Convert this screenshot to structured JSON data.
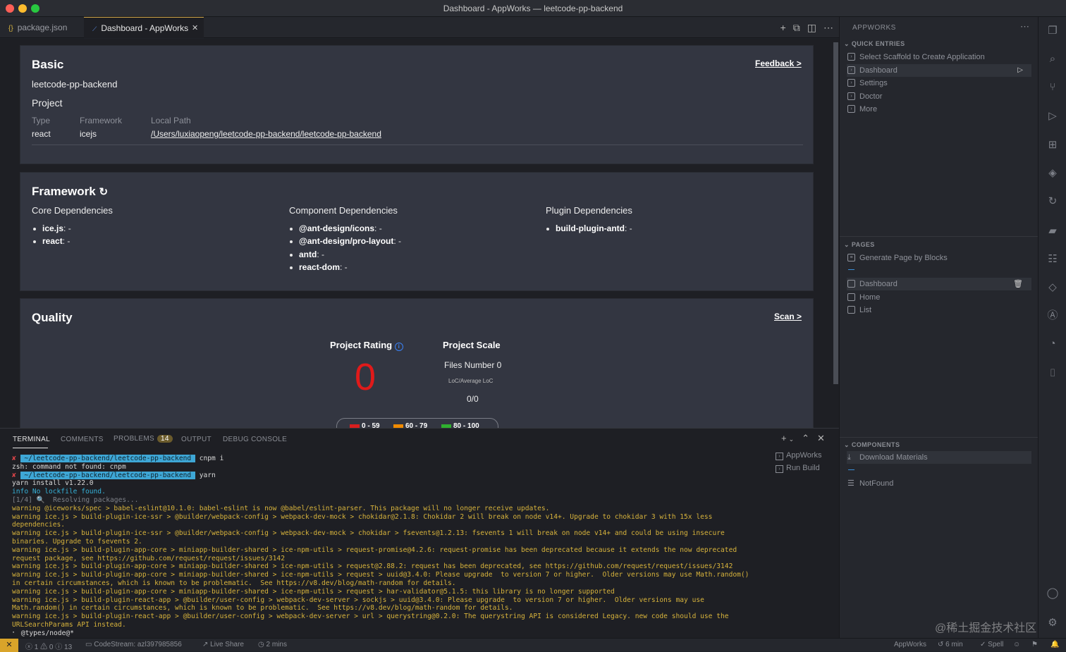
{
  "window": {
    "title": "Dashboard - AppWorks — leetcode-pp-backend"
  },
  "tabs": [
    {
      "label": "package.json",
      "icon": "{}"
    },
    {
      "label": "Dashboard - AppWorks",
      "close": "✕"
    }
  ],
  "basic": {
    "title": "Basic",
    "feedback": "Feedback >",
    "project_name": "leetcode-pp-backend",
    "project_label": "Project",
    "type_label": "Type",
    "framework_label": "Framework",
    "path_label": "Local Path",
    "type_value": "react",
    "framework_value": "icejs",
    "path_value": "/Users/luxiaopeng/leetcode-pp-backend/leetcode-pp-backend"
  },
  "framework": {
    "title": "Framework",
    "core_title": "Core Dependencies",
    "component_title": "Component Dependencies",
    "plugin_title": "Plugin Dependencies",
    "core": [
      {
        "name": "ice.js",
        "val": ": -"
      },
      {
        "name": "react",
        "val": ": -"
      }
    ],
    "component": [
      {
        "name": "@ant-design/icons",
        "val": ": -"
      },
      {
        "name": "@ant-design/pro-layout",
        "val": ": -"
      },
      {
        "name": "antd",
        "val": ": -"
      },
      {
        "name": "react-dom",
        "val": ": -"
      }
    ],
    "plugin": [
      {
        "name": "build-plugin-antd",
        "val": ": -"
      }
    ]
  },
  "quality": {
    "title": "Quality",
    "scan": "Scan >",
    "rating_title": "Project Rating",
    "rating_value": "0",
    "scale_title": "Project Scale",
    "files": "Files Number 0",
    "loc_label": "LoC/Average LoC",
    "loc_value": "0/0",
    "legend": [
      "0 - 59",
      "60 - 79",
      "80 - 100"
    ],
    "legend_colors": [
      "#d81e1e",
      "#f08a00",
      "#2fb02f"
    ]
  },
  "terminal": {
    "tabs": [
      "TERMINAL",
      "COMMENTS",
      "PROBLEMS",
      "OUTPUT",
      "DEBUG CONSOLE"
    ],
    "problems_count": "14",
    "prompt_path": " ~/leetcode-pp-backend/leetcode-pp-backend ",
    "cmd1": "cnpm i",
    "err1": "zsh: command not found: cnpm",
    "cmd2": "yarn",
    "lines": [
      "yarn install v1.22.0",
      "info No lockfile found.",
      "[1/4] 🔍  Resolving packages...",
      "warning @iceworks/spec > babel-eslint@10.1.0: babel-eslint is now @babel/eslint-parser. This package will no longer receive updates.",
      "warning ice.js > build-plugin-ice-ssr > @builder/webpack-config > webpack-dev-mock > chokidar@2.1.8: Chokidar 2 will break on node v14+. Upgrade to chokidar 3 with 15x less dependencies.",
      "warning ice.js > build-plugin-ice-ssr > @builder/webpack-config > webpack-dev-mock > chokidar > fsevents@1.2.13: fsevents 1 will break on node v14+ and could be using insecure binaries. Upgrade to fsevents 2.",
      "warning ice.js > build-plugin-app-core > miniapp-builder-shared > ice-npm-utils > request-promise@4.2.6: request-promise has been deprecated because it extends the now deprecated request package, see https://github.com/request/request/issues/3142",
      "warning ice.js > build-plugin-app-core > miniapp-builder-shared > ice-npm-utils > request@2.88.2: request has been deprecated, see https://github.com/request/request/issues/3142",
      "warning ice.js > build-plugin-app-core > miniapp-builder-shared > ice-npm-utils > request > uuid@3.4.0: Please upgrade  to version 7 or higher.  Older versions may use Math.random() in certain circumstances, which is known to be problematic.  See https://v8.dev/blog/math-random for details.",
      "warning ice.js > build-plugin-app-core > miniapp-builder-shared > ice-npm-utils > request > har-validator@5.1.5: this library is no longer supported",
      "warning ice.js > build-plugin-react-app > @builder/user-config > webpack-dev-server > sockjs > uuid@3.4.0: Please upgrade  to version 7 or higher.  Older versions may use Math.random() in certain circumstances, which is known to be problematic.  See https://v8.dev/blog/math-random for details.",
      "warning ice.js > build-plugin-react-app > @builder/user-config > webpack-dev-server > url > querystring@0.2.0: The querystring API is considered Legacy. new code should use the URLSearchParams API instead.",
      "⠂ @types/node@*"
    ],
    "side": [
      "AppWorks",
      "Run Build"
    ]
  },
  "sidebar": {
    "title": "APPWORKS",
    "quick_title": "QUICK ENTRIES",
    "quick": [
      "Select Scaffold to Create Application",
      "Dashboard",
      "Settings",
      "Doctor",
      "More"
    ],
    "pages_title": "PAGES",
    "pages_generate": "Generate Page by Blocks",
    "pages": [
      "Dashboard",
      "Home",
      "List"
    ],
    "components_title": "COMPONENTS",
    "components_download": "Download Materials",
    "components_none": "NotFound"
  },
  "status": {
    "errors": "1",
    "warnings": "0",
    "info": "13",
    "codestream": "CodeStream: azl397985856",
    "liveshare": "Live Share",
    "time": "2 mins",
    "appworks": "AppWorks",
    "time2": "6 min",
    "spell": "Spell"
  },
  "watermark": "@稀土掘金技术社区"
}
